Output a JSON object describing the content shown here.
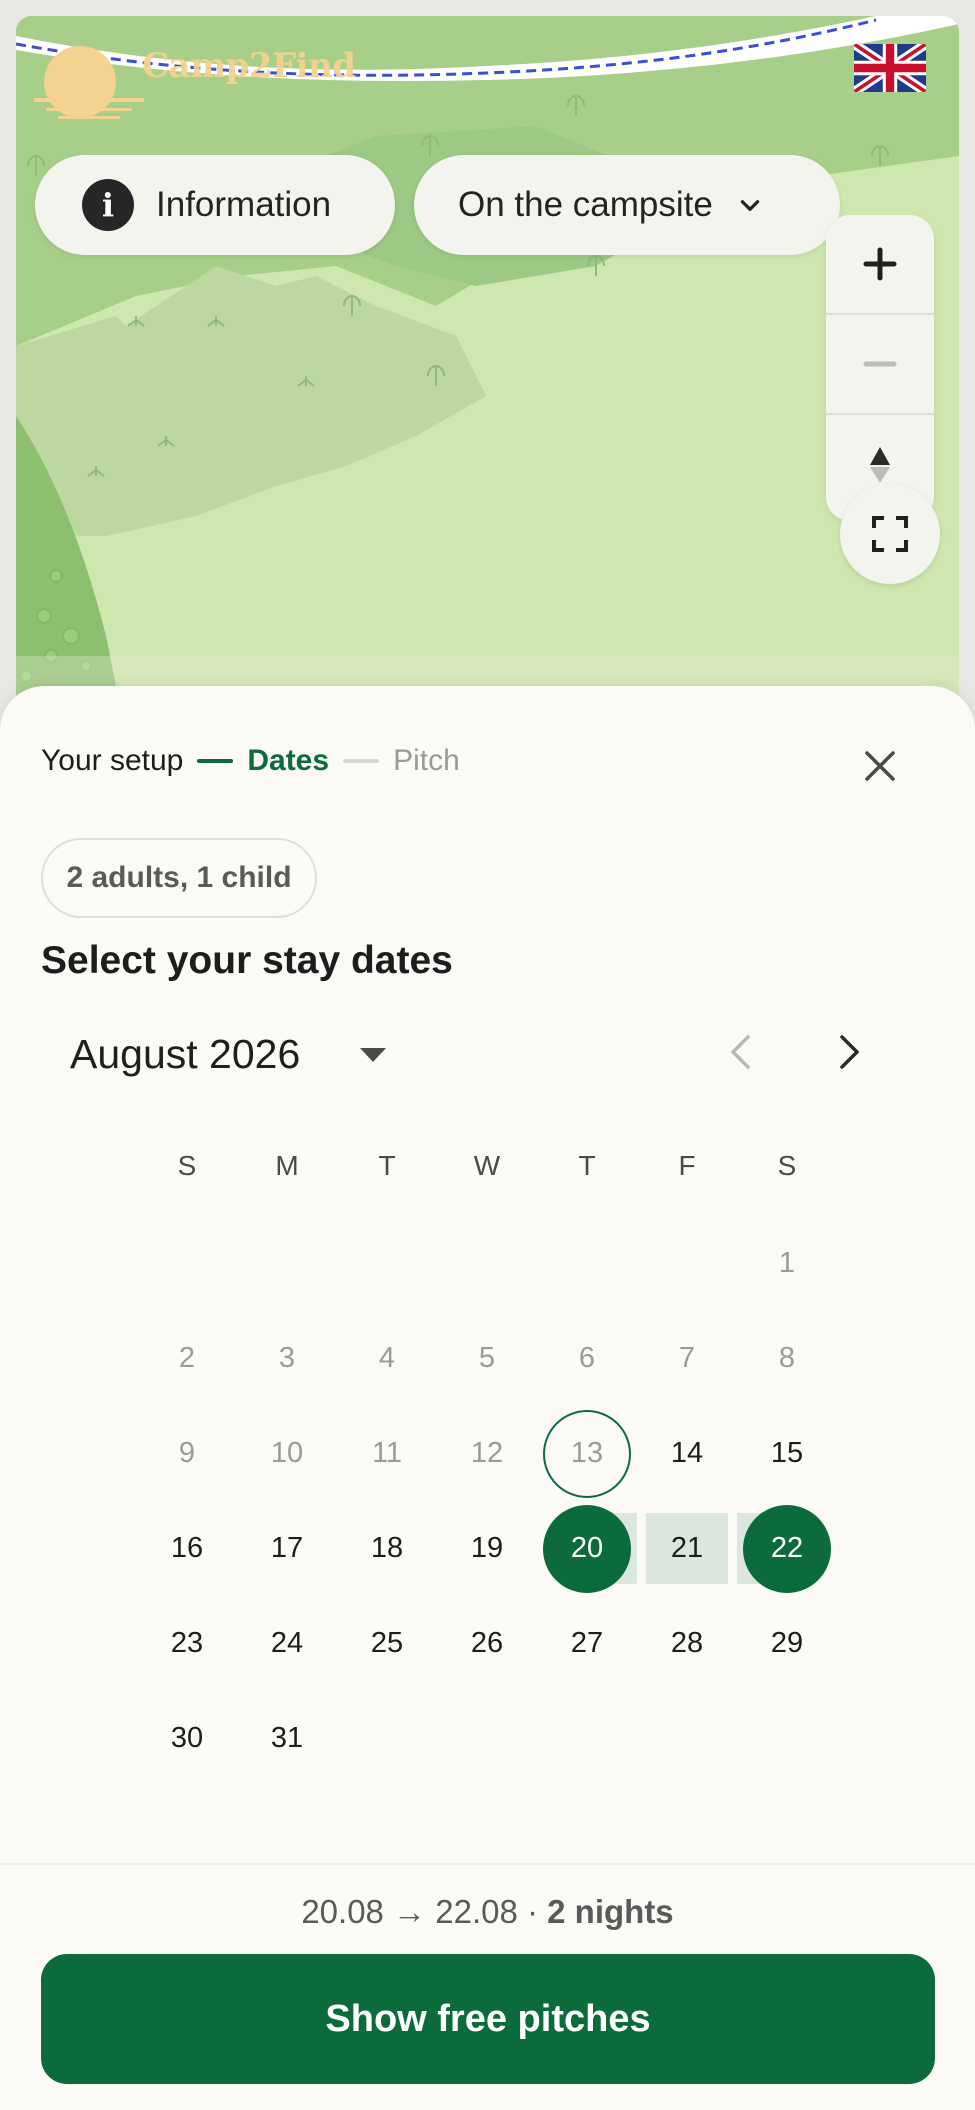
{
  "app": {
    "logo_text": "Camp2Find",
    "language_flag": "uk-flag-icon"
  },
  "map": {
    "info_button_label": "Information",
    "campsite_button_label": "On the campsite",
    "zoom_in_icon": "plus-icon",
    "zoom_out_icon": "minus-icon",
    "compass_icon": "compass-icon",
    "fullscreen_icon": "fullscreen-icon"
  },
  "steps": {
    "setup": "Your setup",
    "dates": "Dates",
    "pitch": "Pitch",
    "current": "Dates"
  },
  "guests_chip": "2 adults, 1 child",
  "title": "Select your stay dates",
  "calendar": {
    "month_label": "August 2026",
    "weekdays": [
      "S",
      "M",
      "T",
      "W",
      "T",
      "F",
      "S"
    ],
    "weeks": [
      [
        "",
        "",
        "",
        "",
        "",
        "",
        "1"
      ],
      [
        "2",
        "3",
        "4",
        "5",
        "6",
        "7",
        "8"
      ],
      [
        "9",
        "10",
        "11",
        "12",
        "13",
        "14",
        "15"
      ],
      [
        "16",
        "17",
        "18",
        "19",
        "20",
        "21",
        "22"
      ],
      [
        "23",
        "24",
        "25",
        "26",
        "27",
        "28",
        "29"
      ],
      [
        "30",
        "31",
        "",
        "",
        "",
        "",
        ""
      ]
    ],
    "today": "13",
    "selected_start": "20",
    "selected_end": "22"
  },
  "summary": {
    "range": "20.08 → 22.08 · ",
    "nights": "2 nights"
  },
  "cta_label": "Show free pitches",
  "colors": {
    "accent": "#0b6b3a",
    "range_band": "#dbe6de",
    "map_green": "#a9d08a"
  }
}
